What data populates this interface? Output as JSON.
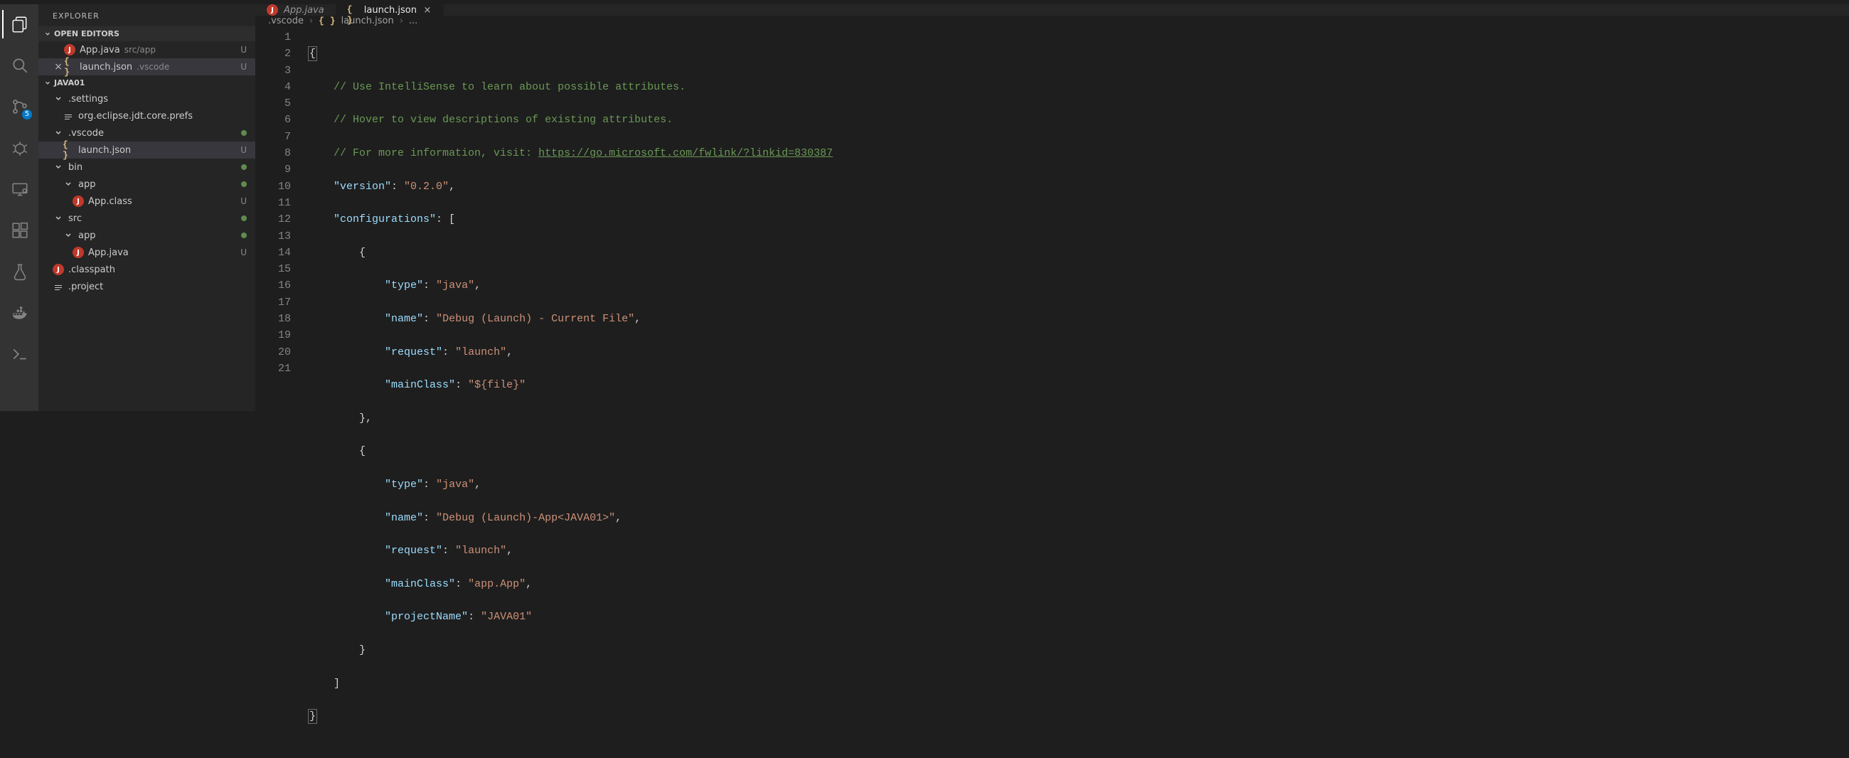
{
  "sidebar_title": "EXPLORER",
  "sections": {
    "open_editors": "OPEN EDITORS",
    "project": "JAVA01"
  },
  "open_editors": [
    {
      "name": "App.java",
      "sub": "src/app",
      "status": "U",
      "icon": "java"
    },
    {
      "name": "launch.json",
      "sub": ".vscode",
      "status": "U",
      "icon": "json",
      "closable": true
    }
  ],
  "tree": [
    {
      "depth": 0,
      "icon": "chev",
      "name": ".settings",
      "status": ""
    },
    {
      "depth": 1,
      "icon": "file",
      "name": "org.eclipse.jdt.core.prefs",
      "status": ""
    },
    {
      "depth": 0,
      "icon": "chev",
      "name": ".vscode",
      "status": "dot"
    },
    {
      "depth": 1,
      "icon": "json",
      "name": "launch.json",
      "status": "U",
      "selected": true
    },
    {
      "depth": 0,
      "icon": "chev",
      "name": "bin",
      "status": "dot"
    },
    {
      "depth": 1,
      "icon": "chev",
      "name": "app",
      "status": "dot"
    },
    {
      "depth": 2,
      "icon": "java",
      "name": "App.class",
      "status": "U"
    },
    {
      "depth": 0,
      "icon": "chev",
      "name": "src",
      "status": "dot"
    },
    {
      "depth": 1,
      "icon": "chev",
      "name": "app",
      "status": "dot"
    },
    {
      "depth": 2,
      "icon": "java",
      "name": "App.java",
      "status": "U"
    },
    {
      "depth": 0,
      "icon": "java",
      "name": ".classpath",
      "status": ""
    },
    {
      "depth": 0,
      "icon": "file",
      "name": ".project",
      "status": ""
    }
  ],
  "scm_badge": "5",
  "tabs": [
    {
      "name": "App.java",
      "icon": "java",
      "active": false
    },
    {
      "name": "launch.json",
      "icon": "json",
      "active": true,
      "close": true
    }
  ],
  "breadcrumb": [
    ".vscode",
    "{}",
    "launch.json",
    "..."
  ],
  "code": {
    "link": "https://go.microsoft.com/fwlink/?linkid=830387",
    "c1": "// Use IntelliSense to learn about possible attributes.",
    "c2": "// Hover to view descriptions of existing attributes.",
    "c3": "// For more information, visit: ",
    "version_k": "\"version\"",
    "version_v": "\"0.2.0\"",
    "conf_k": "\"configurations\"",
    "type_k": "\"type\"",
    "java_v": "\"java\"",
    "name_k": "\"name\"",
    "name_v1": "\"Debug (Launch) - Current File\"",
    "name_v2": "\"Debug (Launch)-App<JAVA01>\"",
    "req_k": "\"request\"",
    "req_v": "\"launch\"",
    "main_k": "\"mainClass\"",
    "main_v1": "\"${file}\"",
    "main_v2": "\"app.App\"",
    "proj_k": "\"projectName\"",
    "proj_v": "\"JAVA01\""
  }
}
